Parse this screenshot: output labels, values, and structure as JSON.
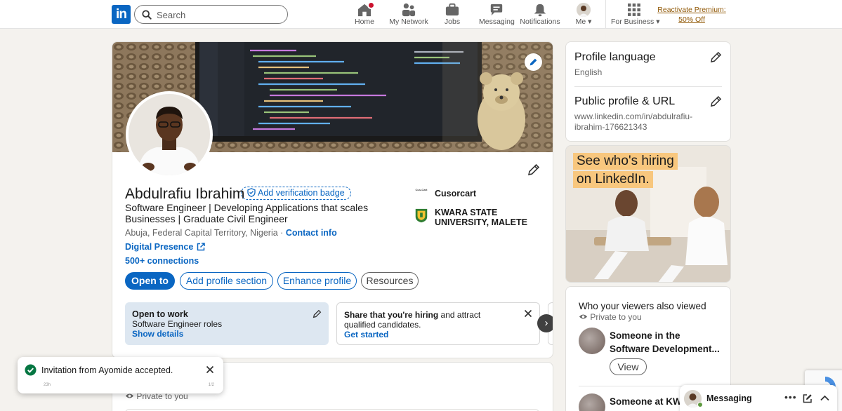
{
  "nav": {
    "logo": "in",
    "search_placeholder": "Search",
    "items": [
      {
        "label": "Home"
      },
      {
        "label": "My Network"
      },
      {
        "label": "Jobs"
      },
      {
        "label": "Messaging"
      },
      {
        "label": "Notifications"
      },
      {
        "label": "Me"
      },
      {
        "label": "For Business"
      }
    ],
    "premium_line1": "Reactivate Premium:",
    "premium_line2": "50% Off"
  },
  "profile": {
    "name": "Abdulrafiu Ibrahim",
    "verify_badge": "Add verification badge",
    "headline": "Software Engineer | Developing Applications that scales Businesses | Graduate Civil Engineer",
    "location": "Abuja, Federal Capital Territory, Nigeria",
    "location_sep": " · ",
    "contact_info": "Contact info",
    "website": "Digital Presence",
    "connections": "500+ connections",
    "experience": [
      {
        "name": "Cusorcart",
        "logo_text": "Cus-Cart"
      },
      {
        "name": "KWARA STATE UNIVERSITY, MALETE"
      }
    ],
    "buttons": {
      "open_to": "Open to",
      "add_section": "Add profile section",
      "enhance": "Enhance profile",
      "resources": "Resources"
    },
    "open_to_work": {
      "title": "Open to work",
      "roles": "Software Engineer roles",
      "link": "Show details"
    },
    "hiring": {
      "bold": "Share that you're hiring",
      "rest": " and attract qualified candidates.",
      "link": "Get started"
    }
  },
  "second_card": {
    "private": "Private to you"
  },
  "sidebar": {
    "language_title": "Profile language",
    "language_value": "English",
    "url_title": "Public profile & URL",
    "url_value": "www.linkedin.com/in/abdulrafiu-ibrahim-176621343",
    "ad_line1": "See who's hiring",
    "ad_line2": "on LinkedIn.",
    "viewers_title": "Who your viewers also viewed",
    "viewers_private": "Private to you",
    "viewer1": "Someone in the Software Development...",
    "view_button": "View",
    "viewer2": "Someone at KWARA STATE UNIVERSITY"
  },
  "toast": {
    "message": "Invitation from Ayomide accepted.",
    "time": "23h",
    "page": "1/2"
  },
  "messaging": {
    "title": "Messaging"
  },
  "colors": {
    "brand": "#0a66c2",
    "premium": "#915907",
    "ad_yellow": "#f8c77e"
  }
}
